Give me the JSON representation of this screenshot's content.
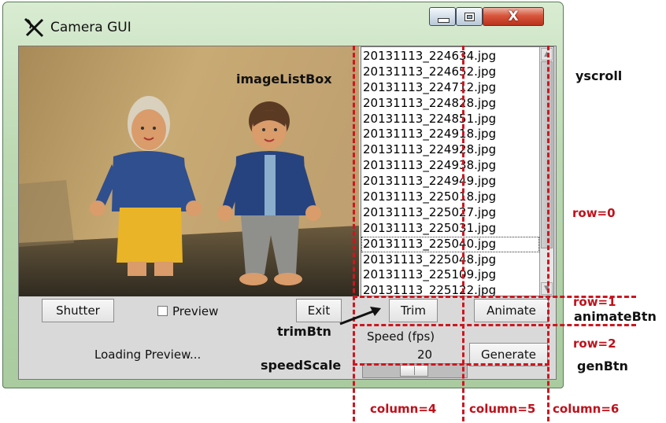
{
  "window": {
    "title": "Camera GUI",
    "close_glyph": "X",
    "icons": [
      "tk-feather-icon",
      "minimize-icon",
      "maximize-icon",
      "close-icon"
    ]
  },
  "listbox": {
    "items": [
      "20131113_224634.jpg",
      "20131113_224652.jpg",
      "20131113_224712.jpg",
      "20131113_224828.jpg",
      "20131113_224851.jpg",
      "20131113_224918.jpg",
      "20131113_224928.jpg",
      "20131113_224938.jpg",
      "20131113_224949.jpg",
      "20131113_225018.jpg",
      "20131113_225027.jpg",
      "20131113_225031.jpg",
      "20131113_225040.jpg",
      "20131113_225048.jpg",
      "20131113_225109.jpg",
      "20131113_225122.jpg"
    ],
    "active_index": 12,
    "scroll_up_glyph": "▲",
    "scroll_down_glyph": "▼"
  },
  "controls": {
    "shutter_label": "Shutter",
    "preview_label": "Preview",
    "preview_checked": false,
    "exit_label": "Exit",
    "trim_label": "Trim",
    "animate_label": "Animate",
    "generate_label": "Generate",
    "loading_text": "Loading Preview...",
    "speed_label": "Speed (fps)",
    "speed_value": "20"
  },
  "annotations": {
    "imageListBox": "imageListBox",
    "yscroll": "yscroll",
    "row0": "row=0",
    "row1": "row=1",
    "animateBtn": "animateBtn",
    "row2": "row=2",
    "genBtn": "genBtn",
    "trimBtn": "trimBtn",
    "speedScale": "speedScale",
    "column4": "column=4",
    "column5": "column=5",
    "column6": "column=6"
  },
  "colors": {
    "annotation_red": "#c0101a",
    "frame_green": "#bcd9b3",
    "close_red": "#d8573c"
  }
}
